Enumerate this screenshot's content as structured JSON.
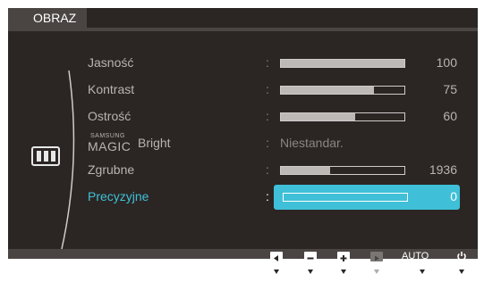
{
  "tab_title": "OBRAZ",
  "menu_icon": "picture-menu-icon",
  "rows": [
    {
      "label": "Jasność",
      "value": "100",
      "level": 100
    },
    {
      "label": "Kontrast",
      "value": "75",
      "level": 75
    },
    {
      "label": "Ostrość",
      "value": "60",
      "level": 60
    },
    {
      "magic_super": "SAMSUNG",
      "magic_main": "MAGIC",
      "label": "Bright",
      "text_value": "Niestandar."
    },
    {
      "label": "Zgrubne",
      "value": "1936",
      "level": 40
    },
    {
      "label": "Precyzyjne",
      "value": "0",
      "level": 0
    }
  ],
  "buttons": {
    "left_icon": "left-arrow-icon",
    "minus_icon": "minus-icon",
    "plus_icon": "plus-icon",
    "enter_icon": "enter-icon",
    "auto_label": "AUTO",
    "power_icon": "power-icon"
  },
  "colors": {
    "background": "#2b2624",
    "highlight": "#3fc0d8",
    "text": "#b8b4b2"
  }
}
